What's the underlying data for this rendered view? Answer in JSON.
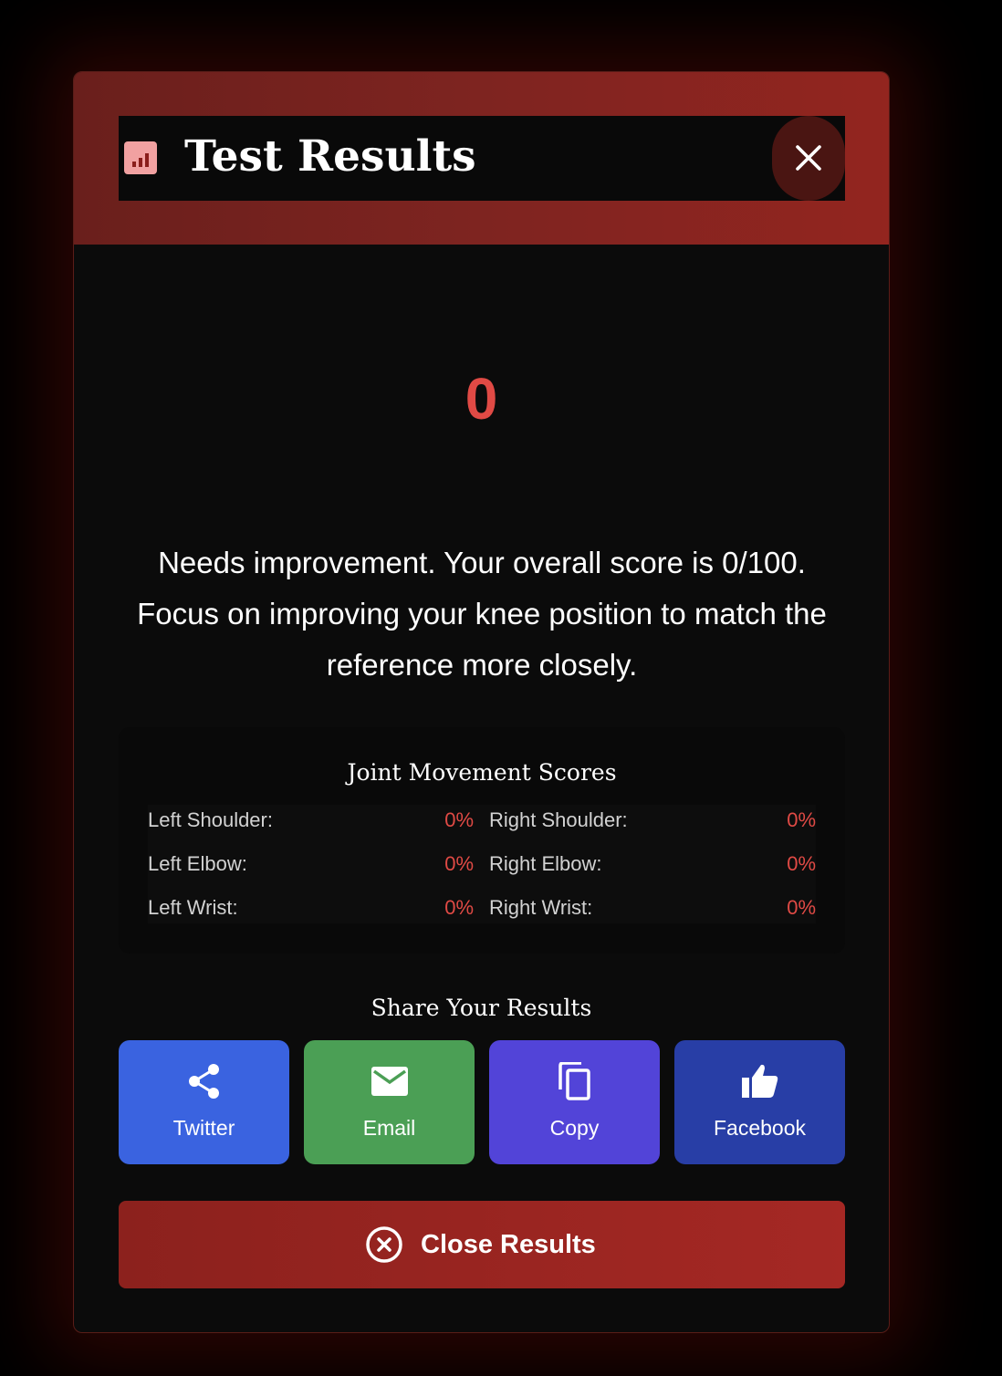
{
  "modal": {
    "title": "Test Results",
    "close_icon": "close-icon",
    "header_icon": "bar-chart-icon"
  },
  "score": {
    "value": "0",
    "color": "#e04a45"
  },
  "message": "Needs improvement. Your overall score is 0/100. Focus on improving your knee position to match the reference more closely.",
  "joints": {
    "title": "Joint Movement Scores",
    "rows": [
      {
        "left": {
          "label": "Left Shoulder:",
          "value": "0%"
        },
        "right": {
          "label": "Right Shoulder:",
          "value": "0%"
        }
      },
      {
        "left": {
          "label": "Left Elbow:",
          "value": "0%"
        },
        "right": {
          "label": "Right Elbow:",
          "value": "0%"
        }
      },
      {
        "left": {
          "label": "Left Wrist:",
          "value": "0%"
        },
        "right": {
          "label": "Right Wrist:",
          "value": "0%"
        }
      }
    ]
  },
  "share": {
    "title": "Share Your Results",
    "buttons": [
      {
        "label": "Twitter",
        "icon": "share-icon",
        "color": "#3a63e0"
      },
      {
        "label": "Email",
        "icon": "email-icon",
        "color": "#4b9f55"
      },
      {
        "label": "Copy",
        "icon": "copy-icon",
        "color": "#5244d8"
      },
      {
        "label": "Facebook",
        "icon": "thumbs-up-icon",
        "color": "#283ea6"
      }
    ]
  },
  "close_button": {
    "label": "Close Results",
    "icon": "close-circle-icon"
  }
}
